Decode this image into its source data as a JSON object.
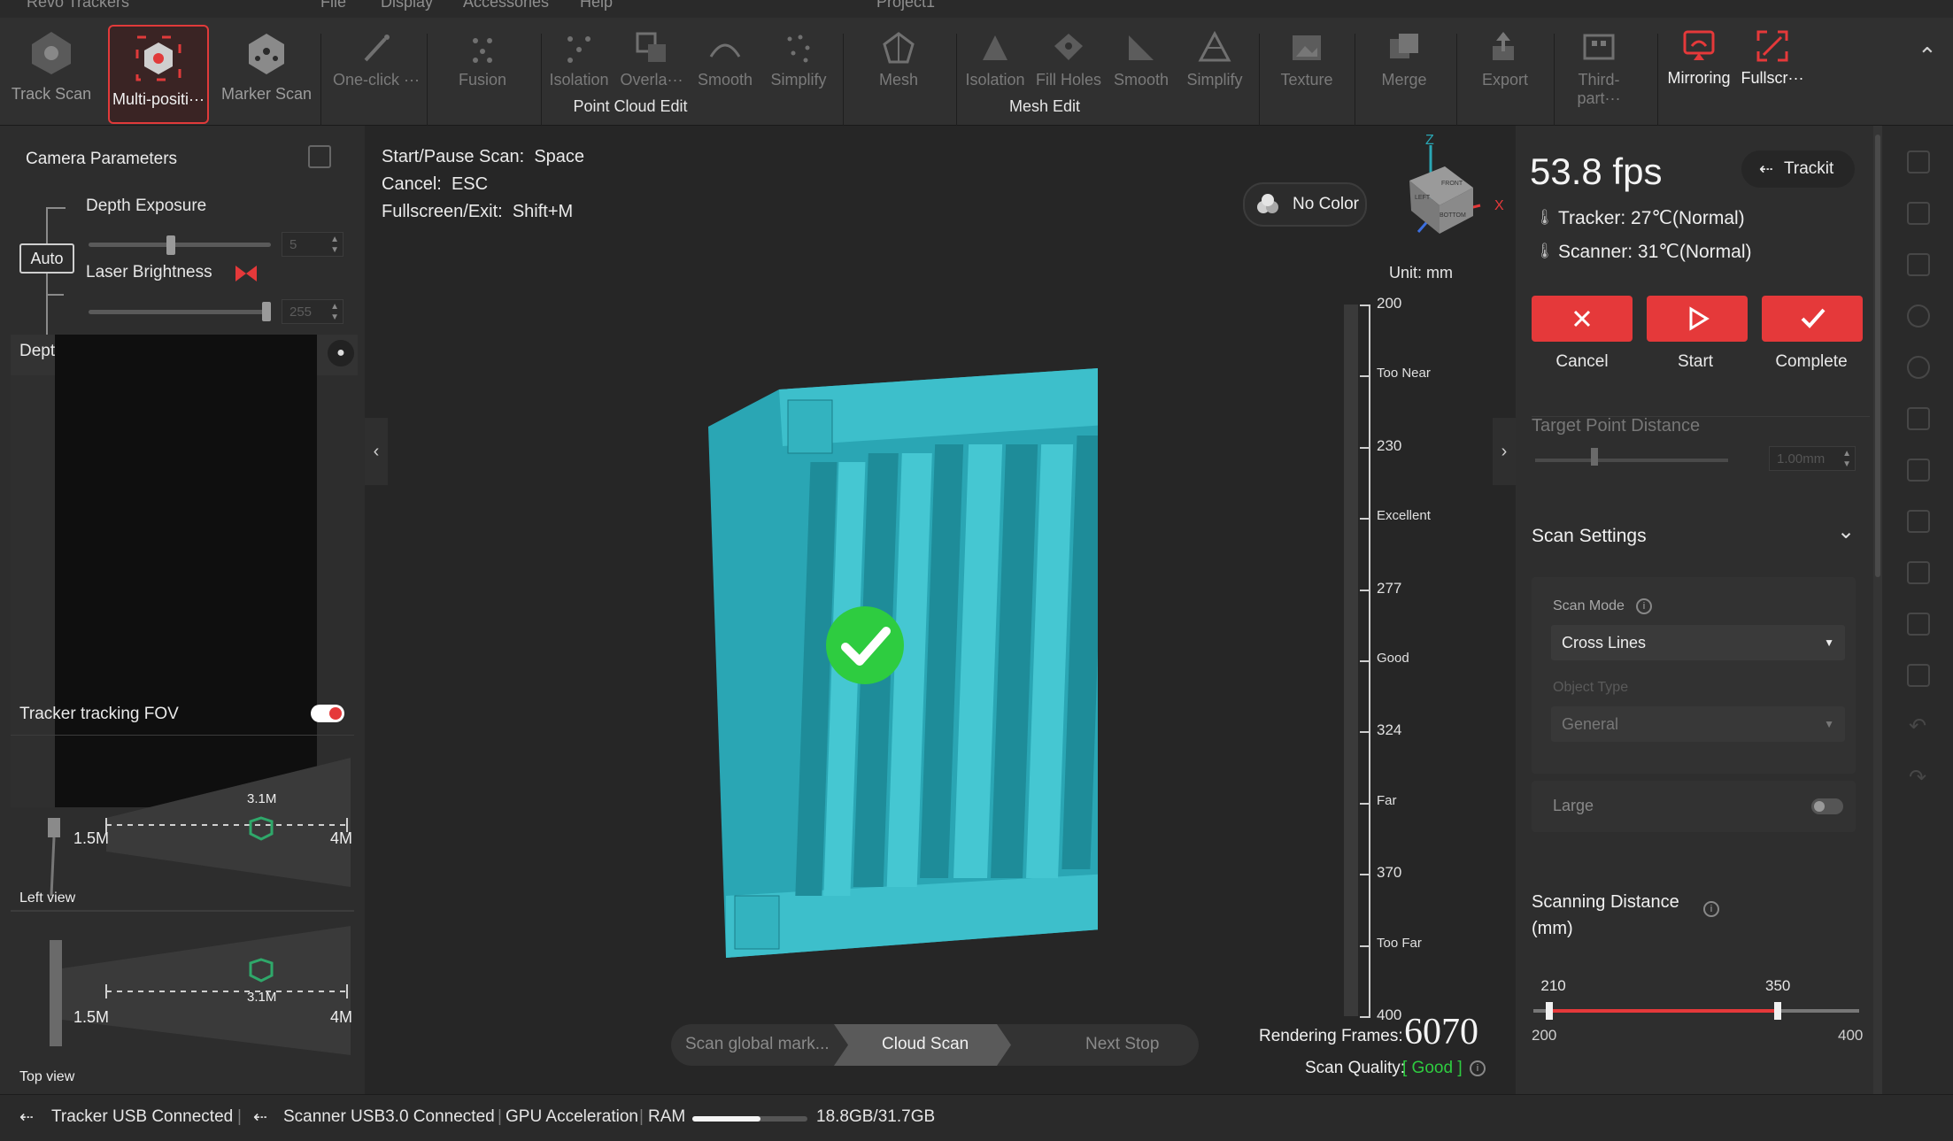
{
  "menubar": {
    "items": [
      "File",
      "Display",
      "Accessories",
      "Help"
    ],
    "app": "Revo Trackers",
    "project": "Project1"
  },
  "toolbar": {
    "scan_modes": [
      {
        "label": "Track Scan",
        "icon": "track-scan-icon"
      },
      {
        "label": "Multi-positi···",
        "icon": "multi-position-icon"
      },
      {
        "label": "Marker Scan",
        "icon": "marker-scan-icon"
      }
    ],
    "one_click": "One-click ···",
    "point_cloud": {
      "group_label": "Point Cloud Edit",
      "tools": [
        "Fusion",
        "Isolation",
        "Overla···",
        "Smooth",
        "Simplify"
      ]
    },
    "mesh": {
      "group_label": "Mesh Edit",
      "tools": [
        "Mesh",
        "Isolation",
        "Fill Holes",
        "Smooth",
        "Simplify"
      ]
    },
    "texture": "Texture",
    "merge": "Merge",
    "export": "Export",
    "third_party": "Third-part···",
    "mirroring": "Mirroring",
    "fullscreen": "Fullscr···"
  },
  "camera_params": {
    "title": "Camera Parameters",
    "auto_label": "Auto",
    "depth_exposure": {
      "label": "Depth Exposure",
      "value": "5",
      "level": 0.45
    },
    "laser_brightness": {
      "label": "Laser Brightness",
      "value": "255",
      "level": 1.0
    }
  },
  "depth_camera": {
    "title": "Depth Camera"
  },
  "tracker_fov": {
    "title": "Tracker tracking FOV",
    "enabled": true,
    "left_view": {
      "label": "Left view",
      "near": "1.5M",
      "mid": "3.1M",
      "far": "4M"
    },
    "top_view": {
      "label": "Top view",
      "near": "1.5M",
      "mid": "3.1M",
      "far": "4M"
    }
  },
  "viewport": {
    "shortcuts": [
      {
        "label": "Start/Pause Scan:",
        "key": "Space"
      },
      {
        "label": "Cancel:",
        "key": "ESC"
      },
      {
        "label": "Fullscreen/Exit:",
        "key": "Shift+M"
      }
    ],
    "color_mode": "No Color",
    "unit": "Unit: mm",
    "axes": {
      "z": "Z",
      "x": "X",
      "cube_front": "FRONT",
      "cube_left": "LEFT",
      "cube_bottom": "BOTTOM"
    },
    "ruler": [
      "200",
      "Too Near",
      "230",
      "Excellent",
      "277",
      "Good",
      "324",
      "Far",
      "370",
      "Too Far",
      "400"
    ],
    "rendering_frames_label": "Rendering Frames:",
    "rendering_frames": "6070",
    "scan_quality_label": "Scan Quality:",
    "scan_quality": "[ Good ]",
    "steps": [
      "Scan global mark...",
      "Cloud Scan",
      "Next Stop"
    ]
  },
  "right_panel": {
    "fps": "53.8 fps",
    "trackit": "Trackit",
    "tracker_temp": "Tracker: 27℃(Normal)",
    "scanner_temp": "Scanner: 31℃(Normal)",
    "buttons": {
      "cancel": "Cancel",
      "start": "Start",
      "complete": "Complete"
    },
    "target_point_distance": {
      "label": "Target Point Distance",
      "value": "1.00mm",
      "level": 0.3
    },
    "scan_settings": {
      "title": "Scan Settings",
      "scan_mode_label": "Scan Mode",
      "scan_mode": "Cross Lines",
      "object_type_label": "Object Type",
      "object_type": "General",
      "large_label": "Large",
      "large_on": false
    },
    "scanning_distance": {
      "title_line1": "Scanning Distance",
      "title_line2": "(mm)",
      "low": "210",
      "high": "350",
      "min": "200",
      "max": "400",
      "range_min": 200,
      "range_max": 400,
      "low_value": 210,
      "high_value": 350
    }
  },
  "status": {
    "tracker_usb": "Tracker USB Connected",
    "scanner_usb": "Scanner USB3.0 Connected",
    "gpu": "GPU Acceleration",
    "ram_label": "RAM",
    "ram_value": "18.8GB/31.7GB",
    "ram_used_fraction": 0.59
  },
  "colors": {
    "accent_red": "#e5393a",
    "mesh_cyan": "#2aa6b4",
    "success_green": "#2ecc40"
  }
}
